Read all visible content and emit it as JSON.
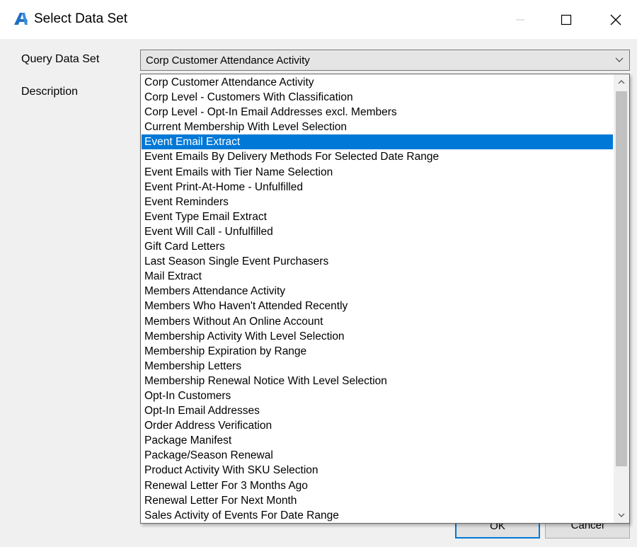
{
  "window": {
    "title": "Select Data Set",
    "icon": "app-logo-icon",
    "controls": [
      "minimize-icon",
      "maximize-icon",
      "close-icon"
    ]
  },
  "form": {
    "query_label": "Query Data Set",
    "description_label": "Description",
    "selected_value": "Corp Customer Attendance Activity"
  },
  "buttons": {
    "ok": "OK",
    "cancel": "Cancel"
  },
  "dropdown": {
    "highlighted_index": 4,
    "items": [
      "Corp Customer Attendance Activity",
      "Corp Level - Customers With Classification",
      "Corp Level - Opt-In Email Addresses excl. Members",
      "Current Membership With Level Selection",
      "Event Email Extract",
      "Event Emails By Delivery Methods For Selected Date Range",
      "Event Emails with Tier Name Selection",
      "Event Print-At-Home - Unfulfilled",
      "Event Reminders",
      "Event Type Email Extract",
      "Event Will Call - Unfulfilled",
      "Gift Card Letters",
      "Last Season Single Event Purchasers",
      "Mail Extract",
      "Members Attendance Activity",
      "Members Who Haven't Attended Recently",
      "Members Without An Online Account",
      "Membership Activity With Level Selection",
      "Membership Expiration by Range",
      "Membership Letters",
      "Membership Renewal Notice With Level Selection",
      "Opt-In Customers",
      "Opt-In Email Addresses",
      "Order Address Verification",
      "Package Manifest",
      "Package/Season Renewal",
      "Product Activity With SKU Selection",
      "Renewal Letter For 3 Months Ago",
      "Renewal Letter For Next Month",
      "Sales Activity of Events For Date Range"
    ]
  },
  "colors": {
    "selection": "#0078d7",
    "accent_logo": "#1f6fc5"
  }
}
